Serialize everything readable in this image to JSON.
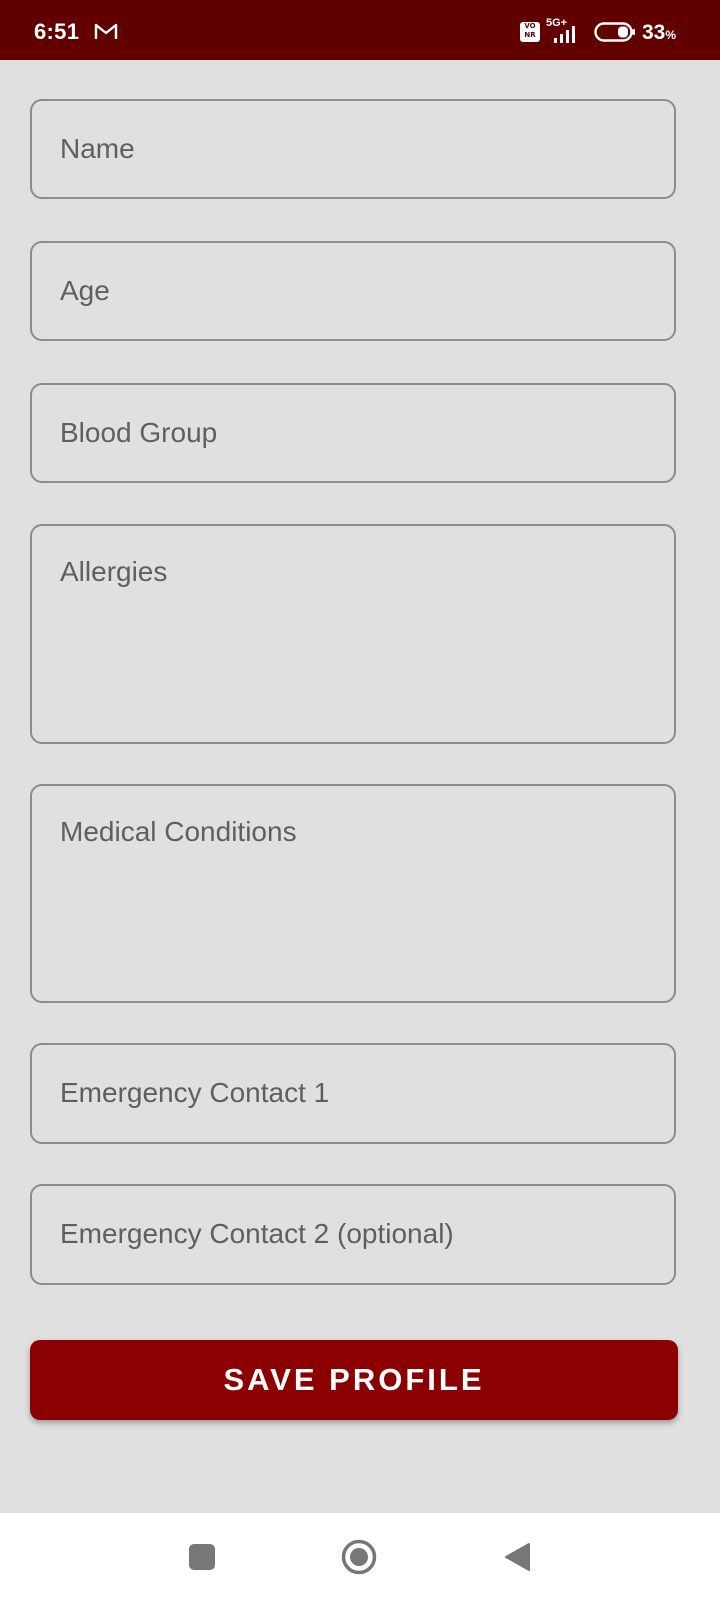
{
  "status_bar": {
    "time": "6:51",
    "network": "5G+",
    "volte": "Vo NR",
    "battery_percent": "33",
    "battery_unit": "%",
    "icons": [
      "gmail-icon",
      "volte-icon",
      "signal-icon",
      "battery-icon"
    ]
  },
  "form": {
    "name": {
      "placeholder": "Name",
      "value": ""
    },
    "age": {
      "placeholder": "Age",
      "value": ""
    },
    "blood_group": {
      "placeholder": "Blood Group",
      "value": ""
    },
    "allergies": {
      "placeholder": "Allergies",
      "value": ""
    },
    "medical_conditions": {
      "placeholder": "Medical Conditions",
      "value": ""
    },
    "emergency_contact_1": {
      "placeholder": "Emergency Contact 1",
      "value": ""
    },
    "emergency_contact_2": {
      "placeholder": "Emergency Contact 2 (optional)",
      "value": ""
    }
  },
  "save_button": {
    "label": "SAVE PROFILE"
  },
  "nav_bar": {
    "icons": [
      "recents-icon",
      "home-icon",
      "back-icon"
    ]
  },
  "colors": {
    "status_bar": "#600000",
    "accent": "#8b0000",
    "background": "#e0e0e0",
    "field_border": "#8c8c8c"
  }
}
